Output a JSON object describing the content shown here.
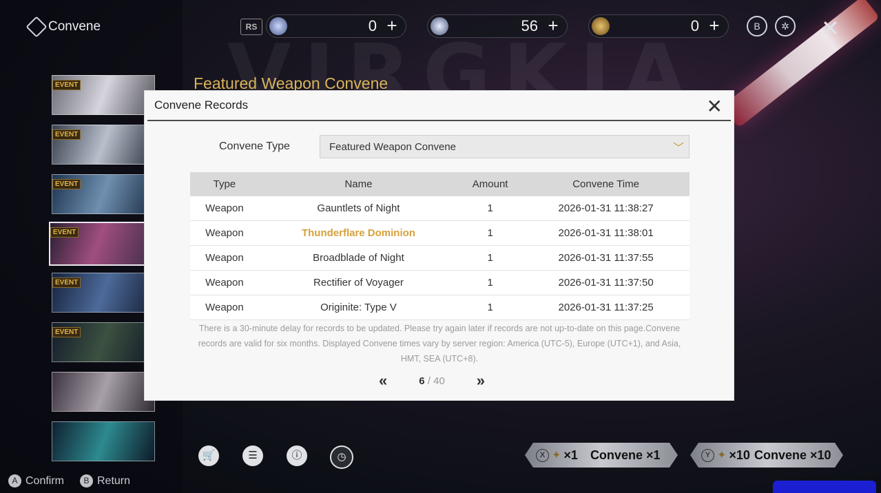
{
  "brand": "Convene",
  "top_bar": {
    "currencies": [
      {
        "name": "lustrous-tide",
        "value": "0"
      },
      {
        "name": "astrite",
        "value": "56"
      },
      {
        "name": "forging-tide",
        "value": "0"
      }
    ],
    "plus": "+"
  },
  "featured_title": "Featured Weapon Convene",
  "banners": [
    {
      "tag": "EVENT"
    },
    {
      "tag": "EVENT"
    },
    {
      "tag": "EVENT"
    },
    {
      "tag": "EVENT"
    },
    {
      "tag": "EVENT"
    },
    {
      "tag": "EVENT"
    },
    {
      "tag": ""
    },
    {
      "tag": ""
    }
  ],
  "modal": {
    "title": "Convene Records",
    "type_label": "Convene Type",
    "type_value": "Featured Weapon Convene",
    "columns": [
      "Type",
      "Name",
      "Amount",
      "Convene Time"
    ],
    "rows": [
      {
        "type": "Weapon",
        "name": "Gauntlets of Night",
        "amount": "1",
        "time": "2026-01-31 11:38:27"
      },
      {
        "type": "Weapon",
        "name": "Thunderflare Dominion",
        "amount": "1",
        "time": "2026-01-31 11:38:01",
        "highlight": true
      },
      {
        "type": "Weapon",
        "name": "Broadblade of Night",
        "amount": "1",
        "time": "2026-01-31 11:37:55"
      },
      {
        "type": "Weapon",
        "name": "Rectifier of Voyager",
        "amount": "1",
        "time": "2026-01-31 11:37:50"
      },
      {
        "type": "Weapon",
        "name": "Originite: Type V",
        "amount": "1",
        "time": "2026-01-31 11:37:25"
      }
    ],
    "notice": "There is a 30-minute delay for records to be updated. Please try again later if records are not up-to-date on this page.Convene records are valid for six months. Displayed Convene times vary by server region: America (UTC-5), Europe (UTC+1), and Asia, HMT, SEA (UTC+8).",
    "page_current": "6",
    "page_total": "/ 40",
    "prev": "«",
    "next": "»"
  },
  "pull": {
    "single_key": "X",
    "single_cost": "×1",
    "single_label": "Convene ×1",
    "ten_key": "Y",
    "ten_cost": "×10",
    "ten_label": "Convene ×10"
  },
  "footer": {
    "confirm_key": "A",
    "confirm_label": "Confirm",
    "return_key": "B",
    "return_label": "Return"
  },
  "colors": {
    "gold": "#d7a13a",
    "accent_title": "#d9b45a"
  }
}
